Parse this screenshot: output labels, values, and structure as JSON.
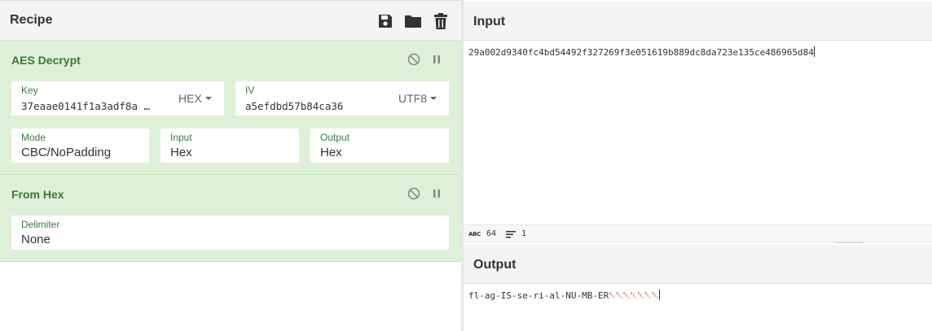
{
  "recipe": {
    "title": "Recipe",
    "icons": [
      "save-icon",
      "folder-icon",
      "trash-icon"
    ]
  },
  "operations": [
    {
      "name": "AES Decrypt",
      "key": {
        "label": "Key",
        "value": "37eaae0141f1a3adf8a …",
        "format": "HEX"
      },
      "iv": {
        "label": "IV",
        "value": "a5efdbd57b84ca36",
        "format": "UTF8"
      },
      "mode": {
        "label": "Mode",
        "value": "CBC/NoPadding"
      },
      "input": {
        "label": "Input",
        "value": "Hex"
      },
      "output": {
        "label": "Output",
        "value": "Hex"
      }
    },
    {
      "name": "From Hex",
      "delimiter": {
        "label": "Delimiter",
        "value": "None"
      }
    }
  ],
  "input": {
    "title": "Input",
    "text": "29a002d9340fc4bd54492f327269f3e051619b889dc8da723e135ce486965d84",
    "stats": {
      "length": "64",
      "lines": "1"
    }
  },
  "output": {
    "title": "Output",
    "text": "fl-ag-IS-se-ri-al-NU-MB-ER",
    "invalid_tail": "␇␇␇␇␇␇␇"
  },
  "colors": {
    "op_background": "#dff0d8",
    "op_title": "#3c763d",
    "header_background": "#f4f4f4"
  }
}
